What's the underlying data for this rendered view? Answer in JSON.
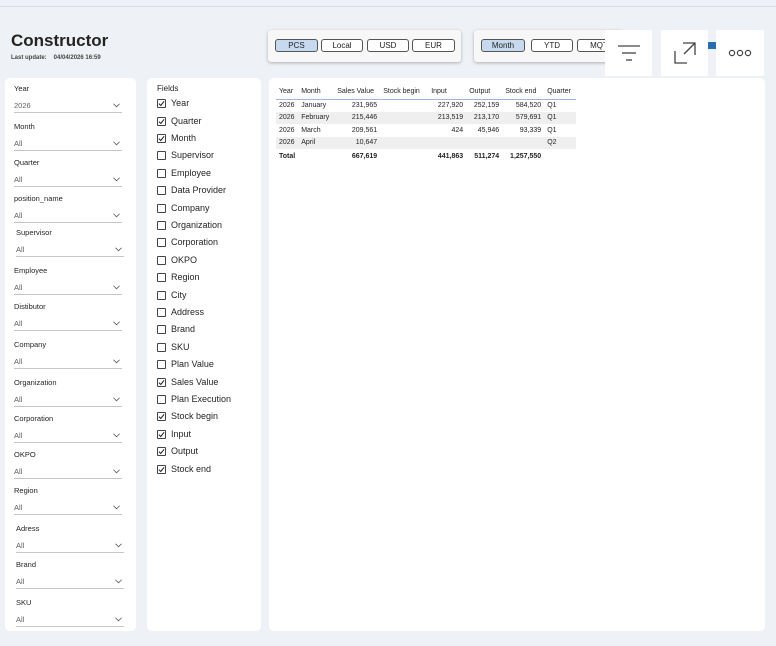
{
  "header": {
    "title": "Constructor",
    "last_update_label": "Last update:",
    "last_update_value": "04/04/2026 16:59"
  },
  "currency_buttons": [
    {
      "label": "PCS",
      "active": true
    },
    {
      "label": "Local",
      "active": false
    },
    {
      "label": "USD",
      "active": false
    },
    {
      "label": "EUR",
      "active": false
    }
  ],
  "period_buttons": [
    {
      "label": "Month",
      "active": true
    },
    {
      "label": "YTD",
      "active": false
    },
    {
      "label": "MQT",
      "active": false
    }
  ],
  "toolbar": {
    "filter_icon": "filter-lines-icon",
    "focus_icon": "focus-mode-icon",
    "more_icon": "more-options-icon"
  },
  "slicers": [
    {
      "label": "Year",
      "value": "2026"
    },
    {
      "label": "Month",
      "value": "All"
    },
    {
      "label": "Quarter",
      "value": "All"
    },
    {
      "label": "position_name",
      "value": "All"
    },
    {
      "label": "Supervisor",
      "value": "All"
    },
    {
      "label": "Employee",
      "value": "All"
    },
    {
      "label": "Distibutor",
      "value": "All"
    },
    {
      "label": "Company",
      "value": "All"
    },
    {
      "label": "Organization",
      "value": "All"
    },
    {
      "label": "Corporation",
      "value": "All"
    },
    {
      "label": "OKPO",
      "value": "All"
    },
    {
      "label": "Region",
      "value": "All"
    },
    {
      "label": "Adress",
      "value": "All"
    },
    {
      "label": "Brand",
      "value": "All"
    },
    {
      "label": "SKU",
      "value": "All"
    }
  ],
  "fields": {
    "title": "Fields",
    "items": [
      {
        "label": "Year",
        "checked": true
      },
      {
        "label": "Quarter",
        "checked": true
      },
      {
        "label": "Month",
        "checked": true
      },
      {
        "label": "Supervisor",
        "checked": false
      },
      {
        "label": "Employee",
        "checked": false
      },
      {
        "label": "Data Provider",
        "checked": false
      },
      {
        "label": "Company",
        "checked": false
      },
      {
        "label": "Organization",
        "checked": false
      },
      {
        "label": "Corporation",
        "checked": false
      },
      {
        "label": "OKPO",
        "checked": false
      },
      {
        "label": "Region",
        "checked": false
      },
      {
        "label": "City",
        "checked": false
      },
      {
        "label": "Address",
        "checked": false
      },
      {
        "label": "Brand",
        "checked": false
      },
      {
        "label": "SKU",
        "checked": false
      },
      {
        "label": "Plan Value",
        "checked": false
      },
      {
        "label": "Sales Value",
        "checked": true
      },
      {
        "label": "Plan Execution",
        "checked": false
      },
      {
        "label": "Stock begin",
        "checked": true
      },
      {
        "label": "Input",
        "checked": true
      },
      {
        "label": "Output",
        "checked": true
      },
      {
        "label": "Stock end",
        "checked": true
      }
    ]
  },
  "matrix": {
    "columns": [
      "Year",
      "Month",
      "Sales Value",
      "Stock begin",
      "Input",
      "Output",
      "Stock end",
      "Quarter"
    ],
    "rows": [
      [
        "2026",
        "January",
        "231,965",
        "",
        "227,920",
        "252,159",
        "584,520",
        "Q1"
      ],
      [
        "2026",
        "February",
        "215,446",
        "",
        "213,519",
        "213,170",
        "579,691",
        "Q1"
      ],
      [
        "2026",
        "March",
        "209,561",
        "",
        "424",
        "45,946",
        "93,339",
        "Q1"
      ],
      [
        "2026",
        "April",
        "10,647",
        "",
        "",
        "",
        "",
        "Q2"
      ]
    ],
    "total": [
      "Total",
      "",
      "667,619",
      "",
      "441,863",
      "511,274",
      "1,257,550",
      ""
    ]
  }
}
